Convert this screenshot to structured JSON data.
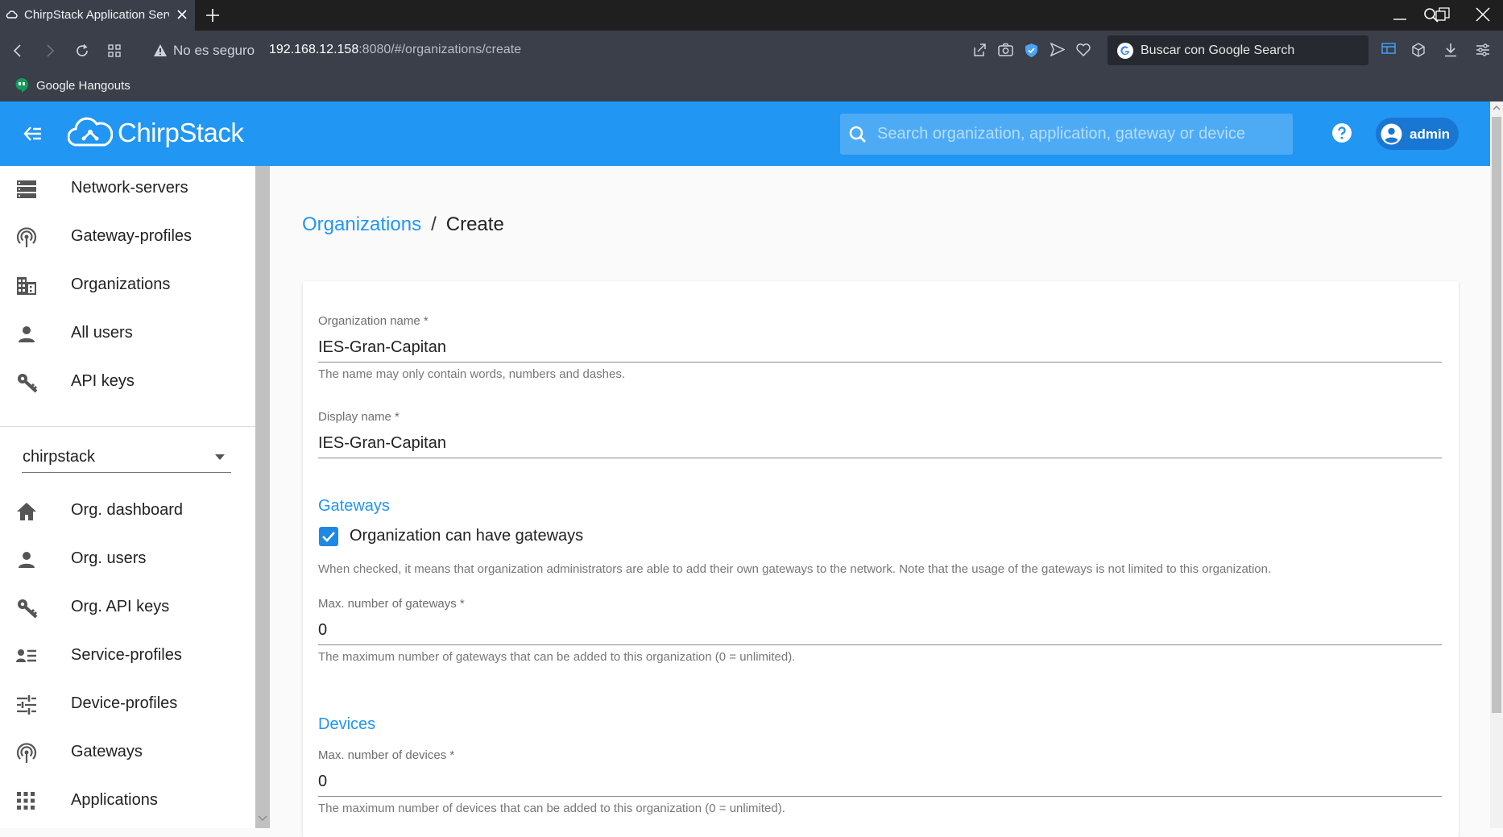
{
  "browser": {
    "tab_title": "ChirpStack Application Server",
    "security_text": "No es seguro",
    "url_host": "192.168.12.158",
    "url_rest": ":8080/#/organizations/create",
    "search_engine_text": "Buscar con Google Search",
    "bookmark": "Google Hangouts"
  },
  "header": {
    "brand": "ChirpStack",
    "search_placeholder": "Search organization, application, gateway or device",
    "user": "admin"
  },
  "sidebar": {
    "items": [
      {
        "label": "Network-servers",
        "icon": "server-icon"
      },
      {
        "label": "Gateway-profiles",
        "icon": "antenna-icon"
      },
      {
        "label": "Organizations",
        "icon": "building-icon"
      },
      {
        "label": "All users",
        "icon": "person-icon"
      },
      {
        "label": "API keys",
        "icon": "key-icon"
      }
    ],
    "org_selected": "chirpstack",
    "org_items": [
      {
        "label": "Org. dashboard",
        "icon": "home-icon"
      },
      {
        "label": "Org. users",
        "icon": "person-icon"
      },
      {
        "label": "Org. API keys",
        "icon": "key-icon"
      },
      {
        "label": "Service-profiles",
        "icon": "list-person-icon"
      },
      {
        "label": "Device-profiles",
        "icon": "tune-icon"
      },
      {
        "label": "Gateways",
        "icon": "antenna-icon"
      },
      {
        "label": "Applications",
        "icon": "apps-icon"
      }
    ]
  },
  "breadcrumb": {
    "parent": "Organizations",
    "separator": "/",
    "current": "Create"
  },
  "form": {
    "org_name": {
      "label": "Organization name *",
      "value": "IES-Gran-Capitan",
      "help": "The name may only contain words, numbers and dashes."
    },
    "display_name": {
      "label": "Display name *",
      "value": "IES-Gran-Capitan"
    },
    "gateways_section": "Gateways",
    "can_have_gateways": {
      "label": "Organization can have gateways",
      "checked": true,
      "help": "When checked, it means that organization administrators are able to add their own gateways to the network. Note that the usage of the gateways is not limited to this organization."
    },
    "max_gateways": {
      "label": "Max. number of gateways *",
      "value": "0",
      "help": "The maximum number of gateways that can be added to this organization (0 = unlimited)."
    },
    "devices_section": "Devices",
    "max_devices": {
      "label": "Max. number of devices *",
      "value": "0",
      "help": "The maximum number of devices that can be added to this organization (0 = unlimited)."
    }
  },
  "colors": {
    "primary": "#2196f3",
    "primary_dark": "#1976d2",
    "browser_chrome": "#3a3f4a"
  }
}
